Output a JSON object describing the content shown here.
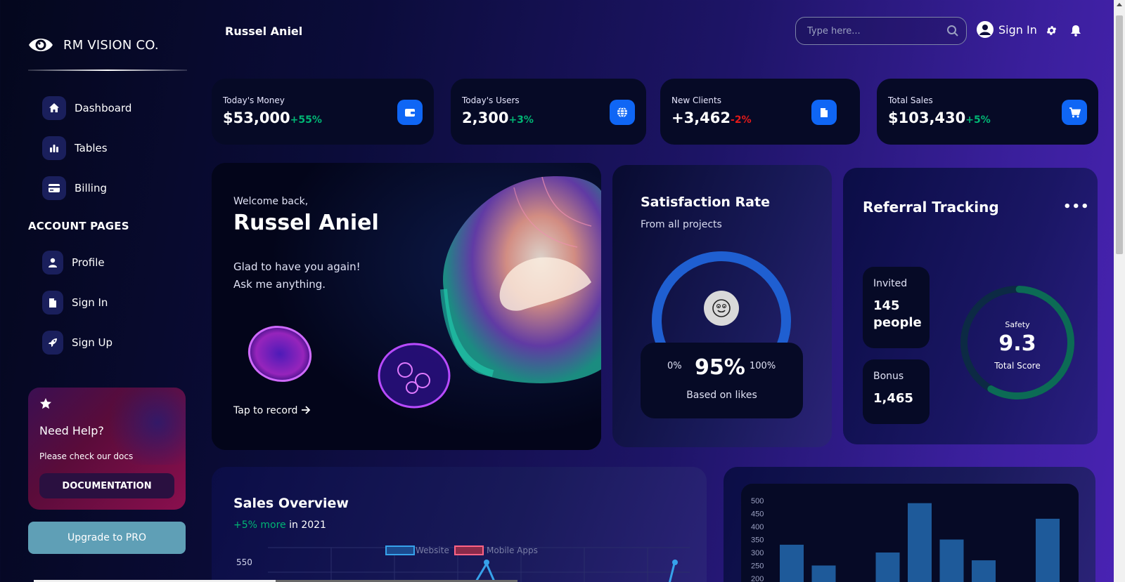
{
  "sidebar": {
    "brand": "RM VISION CO.",
    "nav": [
      {
        "label": "Dashboard",
        "icon": "home-icon"
      },
      {
        "label": "Tables",
        "icon": "bar-chart-icon"
      },
      {
        "label": "Billing",
        "icon": "credit-card-icon"
      }
    ],
    "account_title": "ACCOUNT PAGES",
    "account": [
      {
        "label": "Profile",
        "icon": "user-icon"
      },
      {
        "label": "Sign In",
        "icon": "document-icon"
      },
      {
        "label": "Sign Up",
        "icon": "rocket-icon"
      }
    ],
    "help": {
      "title": "Need Help?",
      "subtitle": "Please check our docs",
      "button": "DOCUMENTATION"
    },
    "upgrade": "Upgrade to PRO"
  },
  "header": {
    "user": "Russel Aniel",
    "search_placeholder": "Type here...",
    "signin": "Sign In"
  },
  "stats": [
    {
      "label": "Today's Money",
      "value": "$53,000",
      "change": "+55%",
      "positive": true,
      "icon": "wallet-icon"
    },
    {
      "label": "Today's Users",
      "value": "2,300",
      "change": "+3%",
      "positive": true,
      "icon": "globe-icon"
    },
    {
      "label": "New Clients",
      "value": "+3,462",
      "change": "-2%",
      "positive": false,
      "icon": "document-icon"
    },
    {
      "label": "Total Sales",
      "value": "$103,430",
      "change": "+5%",
      "positive": true,
      "icon": "cart-icon"
    }
  ],
  "welcome": {
    "greeting": "Welcome back,",
    "name": "Russel Aniel",
    "line1": "Glad to have you again!",
    "line2": "Ask me anything.",
    "cta": "Tap to record"
  },
  "satisfaction": {
    "title": "Satisfaction Rate",
    "subtitle": "From all projects",
    "min": "0%",
    "value": "95%",
    "max": "100%",
    "note": "Based on likes",
    "percent": 95,
    "color": "#1f5fd1"
  },
  "referral": {
    "title": "Referral Tracking",
    "menu": "•••",
    "invited_label": "Invited",
    "invited_value": "145 people",
    "bonus_label": "Bonus",
    "bonus_value": "1,465",
    "score_label": "Safety",
    "score_value": "9.3",
    "score_sub": "Total Score",
    "score_fraction": 0.93,
    "color": "#0c6b55"
  },
  "sales": {
    "title": "Sales Overview",
    "change": "+5% more",
    "period": "in 2021",
    "legend": [
      "Website",
      "Mobile Apps"
    ],
    "ytick_top": "550"
  },
  "chart_data": {
    "type": "bar",
    "yticks": [
      "500",
      "450",
      "400",
      "350",
      "300",
      "250",
      "200"
    ],
    "ylim": [
      200,
      500
    ],
    "values": [
      330,
      250,
      null,
      300,
      490,
      350,
      270,
      null,
      430
    ],
    "color": "#1e5a9a"
  }
}
